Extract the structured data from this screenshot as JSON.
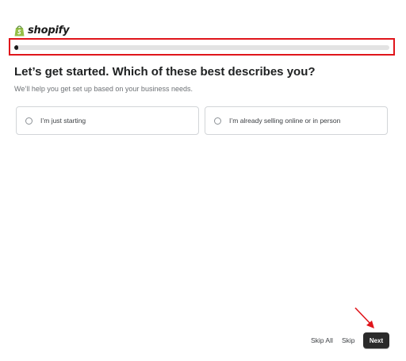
{
  "brand": {
    "name": "shopify",
    "icon": "shopify-bag-icon",
    "color": "#95bf47"
  },
  "progress": {
    "fraction": 0.01,
    "annotation_color": "#e0151b"
  },
  "question": {
    "title": "Let’s get started. Which of these best describes you?",
    "subtitle": "We’ll help you get set up based on your business needs."
  },
  "options": [
    {
      "label": "I’m just starting",
      "selected": false
    },
    {
      "label": "I’m already selling online or in person",
      "selected": false
    }
  ],
  "footer": {
    "skip_all": "Skip All",
    "skip": "Skip",
    "next": "Next"
  },
  "annotation": {
    "arrow_color": "#e0151b"
  }
}
